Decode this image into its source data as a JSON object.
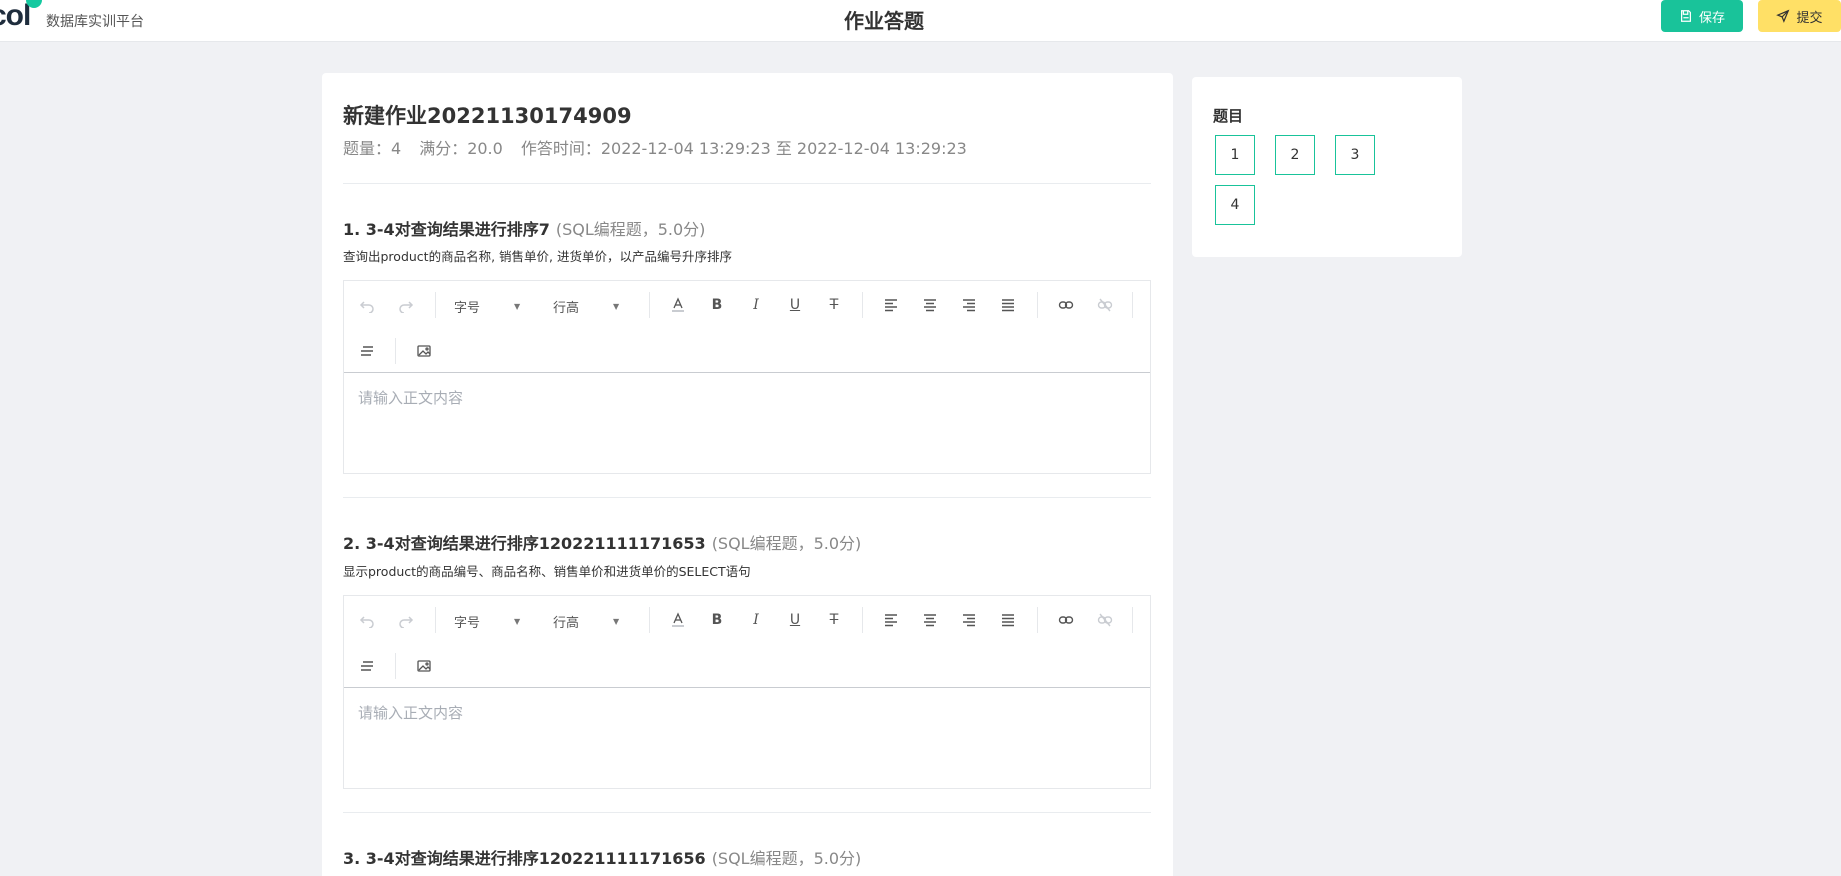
{
  "header": {
    "brand": "数据库实训平台",
    "title": "作业答题",
    "save_label": "保存",
    "submit_label": "提交"
  },
  "homework": {
    "title": "新建作业20221130174909",
    "count": "题量：4",
    "score": "满分：20.0",
    "time": "作答时间：2022-12-04 13:29:23 至 2022-12-04 13:29:23"
  },
  "questions": [
    {
      "head": "1. 3-4对查询结果进行排序7",
      "type": "(SQL编程题，5.0分)",
      "desc": "查询出product的商品名称, 销售单价, 进货单价，以产品编号升序排序",
      "placeholder": "请输入正文内容"
    },
    {
      "head": "2. 3-4对查询结果进行排序120221111171653",
      "type": "(SQL编程题，5.0分)",
      "desc": "显示product的商品编号、商品名称、销售单价和进货单价的SELECT语句",
      "placeholder": "请输入正文内容"
    },
    {
      "head": "3. 3-4对查询结果进行排序120221111171656",
      "type": "(SQL编程题，5.0分)"
    }
  ],
  "toolbar": {
    "font_size_label": "字号",
    "line_height_label": "行高",
    "icons": [
      "undo-icon",
      "redo-icon",
      "font-color-icon",
      "bold-icon",
      "italic-icon",
      "underline-icon",
      "strikethrough-icon",
      "align-left-icon",
      "align-center-icon",
      "align-right-icon",
      "align-justify-icon",
      "link-icon",
      "unlink-icon",
      "indent-icon",
      "image-icon"
    ]
  },
  "sidebar": {
    "title": "题目",
    "numbers": [
      "1",
      "2",
      "3",
      "4"
    ]
  },
  "colors": {
    "accent": "#19c39a",
    "submit": "#ffe066",
    "background": "#f0f1f4"
  }
}
